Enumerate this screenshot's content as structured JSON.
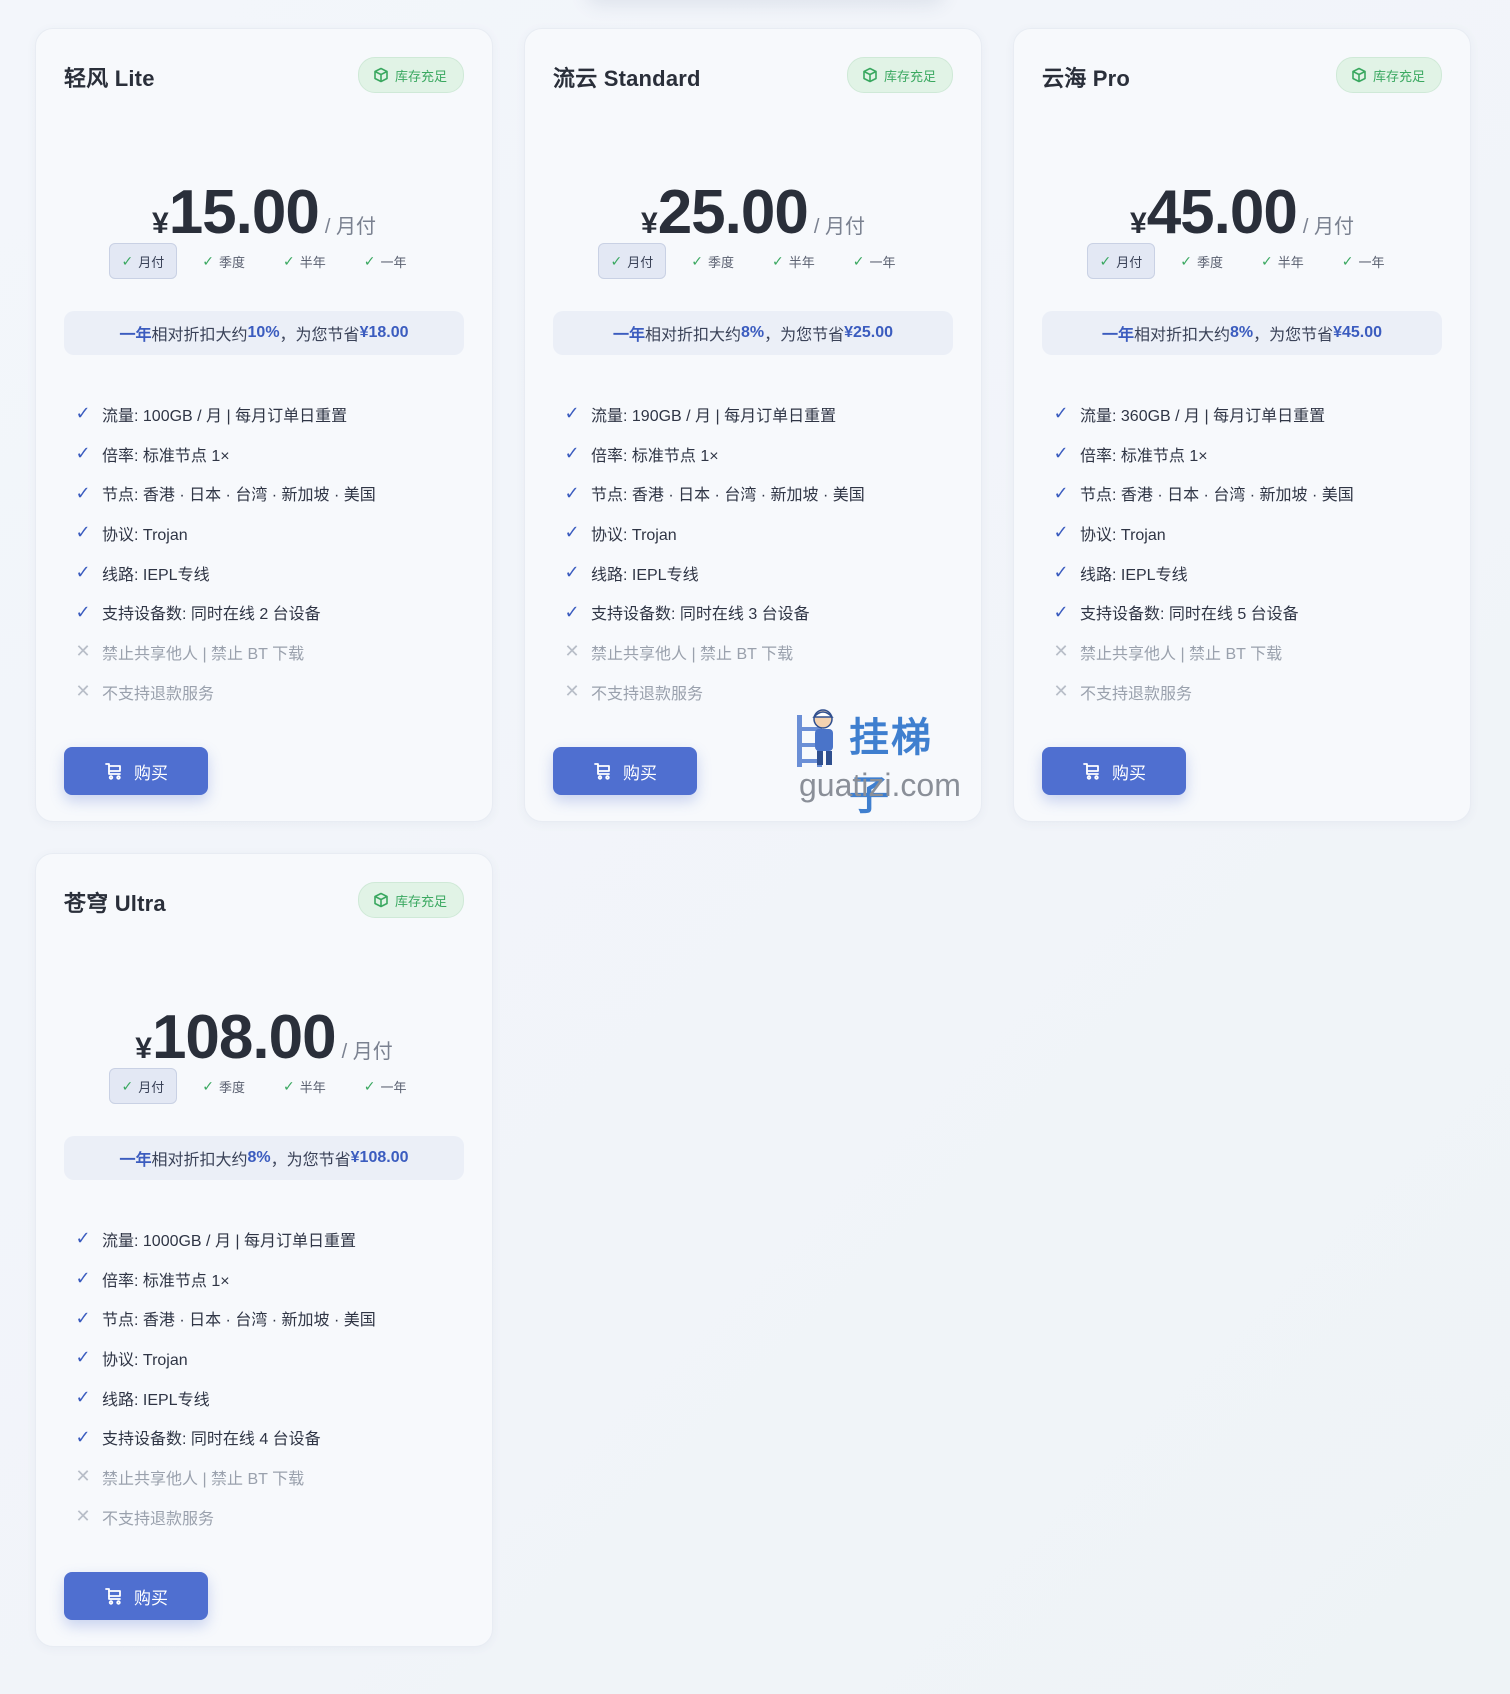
{
  "stock_label": "库存充足",
  "buy_label": "购买",
  "period_unit": "/ 月付",
  "period_options": [
    "月付",
    "季度",
    "半年",
    "一年"
  ],
  "watermark": {
    "title": "挂梯子",
    "domain": "guatizi.com"
  },
  "colors": {
    "accent": "#4f6fd0",
    "check": "#3b5cbf",
    "stock_green": "#3aa860"
  },
  "plans": [
    {
      "name": "轻风 Lite",
      "currency": "¥",
      "price": "15.00",
      "savings": {
        "period": "一年",
        "text1": " 相对折扣大约 ",
        "percent": "10%",
        "text2": "，为您节省 ",
        "amount": "¥18.00"
      },
      "features": [
        {
          "ok": true,
          "text": "流量: 100GB / 月 | 每月订单日重置"
        },
        {
          "ok": true,
          "text": "倍率: 标准节点 1×"
        },
        {
          "ok": true,
          "text": "节点: 香港 · 日本 · 台湾 · 新加坡 · 美国"
        },
        {
          "ok": true,
          "text": "协议: Trojan"
        },
        {
          "ok": true,
          "text": "线路: IEPL专线"
        },
        {
          "ok": true,
          "text": "支持设备数: 同时在线 2 台设备"
        },
        {
          "ok": false,
          "text": "禁止共享他人 | 禁止 BT 下载"
        },
        {
          "ok": false,
          "text": "不支持退款服务"
        }
      ]
    },
    {
      "name": "流云 Standard",
      "currency": "¥",
      "price": "25.00",
      "savings": {
        "period": "一年",
        "text1": " 相对折扣大约 ",
        "percent": "8%",
        "text2": "，为您节省 ",
        "amount": "¥25.00"
      },
      "features": [
        {
          "ok": true,
          "text": "流量: 190GB / 月 | 每月订单日重置"
        },
        {
          "ok": true,
          "text": "倍率: 标准节点 1×"
        },
        {
          "ok": true,
          "text": "节点: 香港 · 日本 · 台湾 · 新加坡 · 美国"
        },
        {
          "ok": true,
          "text": "协议: Trojan"
        },
        {
          "ok": true,
          "text": "线路: IEPL专线"
        },
        {
          "ok": true,
          "text": "支持设备数: 同时在线 3 台设备"
        },
        {
          "ok": false,
          "text": "禁止共享他人 | 禁止 BT 下载"
        },
        {
          "ok": false,
          "text": "不支持退款服务"
        }
      ]
    },
    {
      "name": "云海 Pro",
      "currency": "¥",
      "price": "45.00",
      "savings": {
        "period": "一年",
        "text1": " 相对折扣大约 ",
        "percent": "8%",
        "text2": "，为您节省 ",
        "amount": "¥45.00"
      },
      "features": [
        {
          "ok": true,
          "text": "流量: 360GB / 月 | 每月订单日重置"
        },
        {
          "ok": true,
          "text": "倍率: 标准节点 1×"
        },
        {
          "ok": true,
          "text": "节点: 香港 · 日本 · 台湾 · 新加坡 · 美国"
        },
        {
          "ok": true,
          "text": "协议: Trojan"
        },
        {
          "ok": true,
          "text": "线路: IEPL专线"
        },
        {
          "ok": true,
          "text": "支持设备数: 同时在线 5 台设备"
        },
        {
          "ok": false,
          "text": "禁止共享他人 | 禁止 BT 下载"
        },
        {
          "ok": false,
          "text": "不支持退款服务"
        }
      ]
    },
    {
      "name": "苍穹 Ultra",
      "currency": "¥",
      "price": "108.00",
      "savings": {
        "period": "一年",
        "text1": " 相对折扣大约 ",
        "percent": "8%",
        "text2": "，为您节省 ",
        "amount": "¥108.00"
      },
      "features": [
        {
          "ok": true,
          "text": "流量: 1000GB / 月 | 每月订单日重置"
        },
        {
          "ok": true,
          "text": "倍率: 标准节点 1×"
        },
        {
          "ok": true,
          "text": "节点: 香港 · 日本 · 台湾 · 新加坡 · 美国"
        },
        {
          "ok": true,
          "text": "协议: Trojan"
        },
        {
          "ok": true,
          "text": "线路: IEPL专线"
        },
        {
          "ok": true,
          "text": "支持设备数: 同时在线 4 台设备"
        },
        {
          "ok": false,
          "text": "禁止共享他人 | 禁止 BT 下载"
        },
        {
          "ok": false,
          "text": "不支持退款服务"
        }
      ]
    }
  ]
}
